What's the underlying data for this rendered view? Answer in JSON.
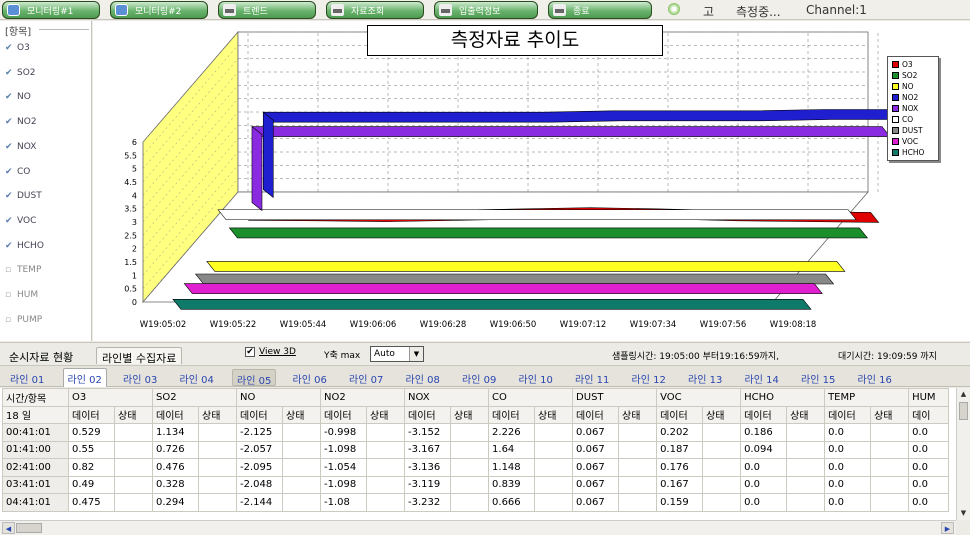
{
  "toolbar": {
    "buttons": [
      "모니터링#1",
      "모니터링#2",
      "트렌드",
      "자료조회",
      "입출력정보",
      "종료"
    ],
    "status_char": "고",
    "status_text": "측정중...",
    "channel": "Channel:1"
  },
  "items_panel": {
    "title": "[항목]",
    "items": [
      {
        "label": "O3",
        "checked": true
      },
      {
        "label": "SO2",
        "checked": true
      },
      {
        "label": "NO",
        "checked": true
      },
      {
        "label": "NO2",
        "checked": true
      },
      {
        "label": "NOX",
        "checked": true
      },
      {
        "label": "CO",
        "checked": true
      },
      {
        "label": "DUST",
        "checked": true
      },
      {
        "label": "VOC",
        "checked": true
      },
      {
        "label": "HCHO",
        "checked": true
      },
      {
        "label": "TEMP",
        "checked": false
      },
      {
        "label": "HUM",
        "checked": false
      },
      {
        "label": "PUMP",
        "checked": false
      }
    ]
  },
  "chart_data": {
    "type": "line",
    "title": "측정자료 추이도",
    "view3d": true,
    "ylim": [
      0,
      6
    ],
    "yticks": [
      "0",
      "0.5",
      "1",
      "1.5",
      "2",
      "2.5",
      "3",
      "3.5",
      "4",
      "4.5",
      "5",
      "5.5",
      "6"
    ],
    "x": [
      "W19:05:02",
      "W19:05:22",
      "W19:05:44",
      "W19:06:06",
      "W19:06:28",
      "W19:06:50",
      "W19:07:12",
      "W19:07:34",
      "W19:07:56",
      "W19:08:18"
    ],
    "series": [
      {
        "name": "O3",
        "color": "#e00000",
        "values": [
          0.5,
          0.48,
          0.45,
          0.5,
          0.55,
          0.6,
          0.55,
          0.48,
          0.45,
          0.42
        ]
      },
      {
        "name": "SO2",
        "color": "#1a8f2c",
        "values": [
          0.33,
          0.33,
          0.33,
          0.33,
          0.33,
          0.33,
          0.33,
          0.33,
          0.33,
          0.33
        ]
      },
      {
        "name": "NO",
        "color": "#ffff22",
        "values": [
          0.05,
          0.05,
          0.05,
          0.05,
          0.05,
          0.05,
          0.05,
          0.05,
          0.05,
          0.05
        ]
      },
      {
        "name": "NO2",
        "color": "#1f1fd0",
        "values": [
          3.2,
          3.2,
          3.2,
          3.2,
          3.2,
          3.25,
          3.25,
          3.25,
          3.3,
          3.3
        ]
      },
      {
        "name": "NOX",
        "color": "#8a2be2",
        "values": [
          3.15,
          3.15,
          3.15,
          3.15,
          3.15,
          3.15,
          3.15,
          3.15,
          3.15,
          3.15
        ]
      },
      {
        "name": "CO",
        "color": "#ffffff",
        "values": [
          1.5,
          1.5,
          1.5,
          1.5,
          1.5,
          1.5,
          1.5,
          1.5,
          1.5,
          1.5
        ]
      },
      {
        "name": "DUST",
        "color": "#888888",
        "values": [
          0.07,
          0.07,
          0.07,
          0.07,
          0.07,
          0.07,
          0.07,
          0.07,
          0.07,
          0.07
        ]
      },
      {
        "name": "VOC",
        "color": "#e020d0",
        "values": [
          0.2,
          0.2,
          0.2,
          0.2,
          0.2,
          0.2,
          0.2,
          0.2,
          0.2,
          0.2
        ]
      },
      {
        "name": "HCHO",
        "color": "#0f7a6a",
        "values": [
          0.1,
          0.1,
          0.1,
          0.1,
          0.1,
          0.1,
          0.1,
          0.1,
          0.1,
          0.1
        ]
      }
    ]
  },
  "controls": {
    "view_tabs": [
      "순시자료 현황",
      "라인별 수집자료"
    ],
    "view3d_label": "View 3D",
    "ymax_label": "Y축 max",
    "ymax_value": "Auto",
    "sampling_text": "샘플링시간: 19:05:00 부터19:16:59까지,",
    "wait_text": "대기시간: 19:09:59 까지"
  },
  "line_tabs": [
    "라인 01",
    "라인 02",
    "라인 03",
    "라인 04",
    "라인 05",
    "라인 06",
    "라인 07",
    "라인 08",
    "라인 09",
    "라인 10",
    "라인 11",
    "라인 12",
    "라인 13",
    "라인 14",
    "라인 15",
    "라인 16"
  ],
  "table": {
    "header1": [
      "시간/항목",
      "O3",
      "SO2",
      "NO",
      "NO2",
      "NOX",
      "CO",
      "DUST",
      "VOC",
      "HCHO",
      "TEMP",
      "HUM"
    ],
    "header2": [
      "18 일",
      "데이터",
      "상태",
      "데이터",
      "상태",
      "데이터",
      "상태",
      "데이터",
      "상태",
      "데이터",
      "상태",
      "데이터",
      "상태",
      "데이터",
      "상태",
      "데이터",
      "상태",
      "데이터",
      "상태",
      "데이터",
      "상태",
      "데이"
    ],
    "rows": [
      {
        "time": "00:41:01",
        "cells": [
          "0.529",
          "",
          "1.134",
          "",
          "-2.125",
          "",
          "-0.998",
          "",
          "-3.152",
          "",
          "2.226",
          "",
          "0.067",
          "",
          "0.202",
          "",
          "0.186",
          "",
          "0.0",
          "",
          "0.0"
        ]
      },
      {
        "time": "01:41:00",
        "cells": [
          "0.55",
          "",
          "0.726",
          "",
          "-2.057",
          "",
          "-1.098",
          "",
          "-3.167",
          "",
          "1.64",
          "",
          "0.067",
          "",
          "0.187",
          "",
          "0.094",
          "",
          "0.0",
          "",
          "0.0"
        ]
      },
      {
        "time": "02:41:00",
        "cells": [
          "0.82",
          "",
          "0.476",
          "",
          "-2.095",
          "",
          "-1.054",
          "",
          "-3.136",
          "",
          "1.148",
          "",
          "0.067",
          "",
          "0.176",
          "",
          "0.0",
          "",
          "0.0",
          "",
          "0.0"
        ]
      },
      {
        "time": "03:41:01",
        "cells": [
          "0.49",
          "",
          "0.328",
          "",
          "-2.048",
          "",
          "-1.098",
          "",
          "-3.119",
          "",
          "0.839",
          "",
          "0.067",
          "",
          "0.167",
          "",
          "0.0",
          "",
          "0.0",
          "",
          "0.0"
        ]
      },
      {
        "time": "04:41:01",
        "cells": [
          "0.475",
          "",
          "0.294",
          "",
          "-2.144",
          "",
          "-1.08",
          "",
          "-3.232",
          "",
          "0.666",
          "",
          "0.067",
          "",
          "0.159",
          "",
          "0.0",
          "",
          "0.0",
          "",
          "0.0"
        ]
      }
    ]
  }
}
